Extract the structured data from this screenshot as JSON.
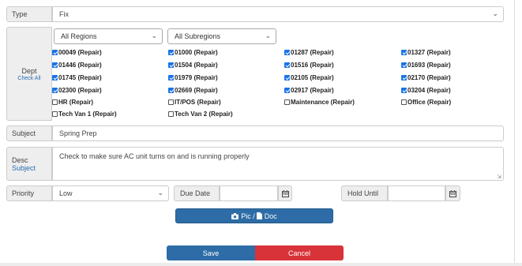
{
  "type": {
    "label": "Type",
    "value": "Fix"
  },
  "dept": {
    "label": "Dept",
    "check_all": "Check All",
    "region_select": "All Regions",
    "subregion_select": "All Subregions",
    "items": [
      {
        "label": "00049 (Repair)",
        "checked": true
      },
      {
        "label": "01000 (Repair)",
        "checked": true
      },
      {
        "label": "01287 (Repair)",
        "checked": true
      },
      {
        "label": "01327 (Repair)",
        "checked": true
      },
      {
        "label": "01446 (Repair)",
        "checked": true
      },
      {
        "label": "01504 (Repair)",
        "checked": true
      },
      {
        "label": "01516 (Repair)",
        "checked": true
      },
      {
        "label": "01693 (Repair)",
        "checked": true
      },
      {
        "label": "01745 (Repair)",
        "checked": true
      },
      {
        "label": "01979 (Repair)",
        "checked": true
      },
      {
        "label": "02105 (Repair)",
        "checked": true
      },
      {
        "label": "02170 (Repair)",
        "checked": true
      },
      {
        "label": "02300 (Repair)",
        "checked": true
      },
      {
        "label": "02669 (Repair)",
        "checked": true
      },
      {
        "label": "02917 (Repair)",
        "checked": true
      },
      {
        "label": "03204 (Repair)",
        "checked": true
      },
      {
        "label": "HR (Repair)",
        "checked": false
      },
      {
        "label": "IT/POS (Repair)",
        "checked": false
      },
      {
        "label": "Maintenance (Repair)",
        "checked": false
      },
      {
        "label": "Office (Repair)",
        "checked": false
      },
      {
        "label": "Tech Van 1 (Repair)",
        "checked": false
      },
      {
        "label": "Tech Van 2 (Repair)",
        "checked": false
      }
    ]
  },
  "subject": {
    "label": "Subject",
    "value": "Spring Prep"
  },
  "desc": {
    "label": "Desc",
    "sublink": "Subject",
    "value": "Check to make sure AC unit turns on and is running properly"
  },
  "priority": {
    "label": "Priority",
    "value": "Low"
  },
  "due_date": {
    "label": "Due Date",
    "value": ""
  },
  "hold_until": {
    "label": "Hold Until",
    "value": ""
  },
  "attach_button": {
    "label": "Pic / ",
    "label2": "Doc"
  },
  "save_button": {
    "label": "Save"
  },
  "cancel_button": {
    "label": "Cancel"
  },
  "colors": {
    "primary": "#2d6ca6",
    "danger": "#d9333a"
  }
}
